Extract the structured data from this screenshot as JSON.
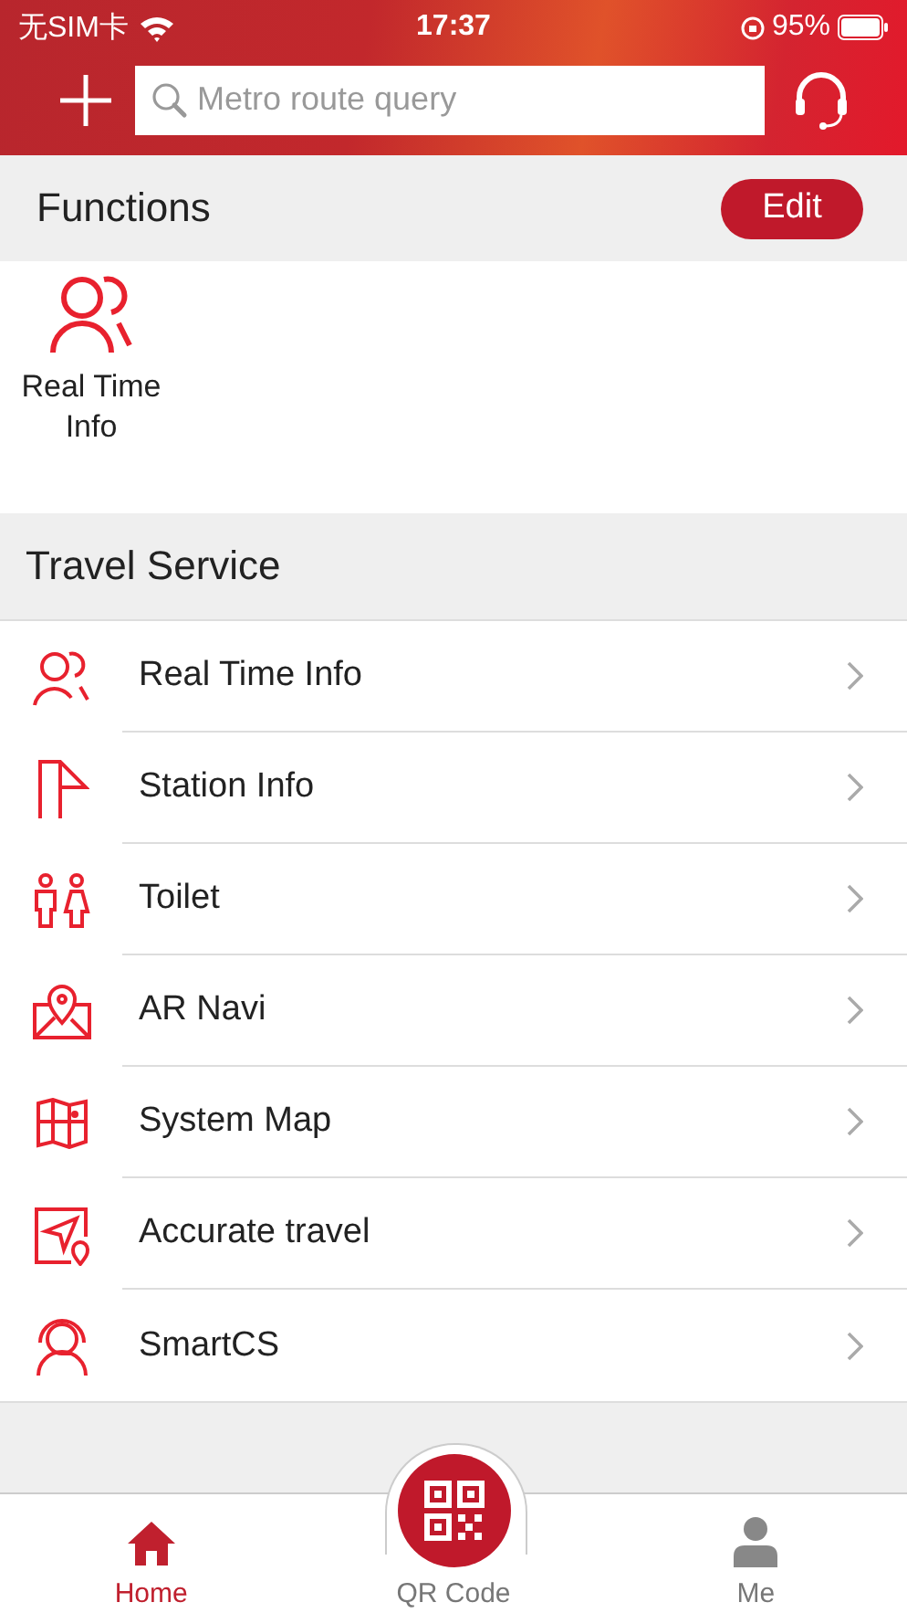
{
  "status_bar": {
    "carrier": "无SIM卡",
    "time": "17:37",
    "battery": "95%"
  },
  "header": {
    "search": {
      "placeholder": "Metro route query"
    }
  },
  "functions": {
    "title": "Functions",
    "edit_button": "Edit",
    "items": [
      {
        "label": "Real Time Info",
        "kind": "people"
      }
    ]
  },
  "travel_service": {
    "title": "Travel Service",
    "items": [
      {
        "label": "Real Time Info",
        "kind": "people"
      },
      {
        "label": "Station Info",
        "kind": "flag"
      },
      {
        "label": "Toilet",
        "kind": "toilet"
      },
      {
        "label": "AR Navi",
        "kind": "pinmap"
      },
      {
        "label": "System Map",
        "kind": "map"
      },
      {
        "label": "Accurate travel",
        "kind": "navigate"
      },
      {
        "label": "SmartCS",
        "kind": "agent"
      }
    ]
  },
  "tab_bar": [
    {
      "label": "Home",
      "kind": "home",
      "selected": true
    },
    {
      "label": "QR Code",
      "kind": "qr",
      "selected": false
    },
    {
      "label": "Me",
      "kind": "person",
      "selected": false
    }
  ]
}
